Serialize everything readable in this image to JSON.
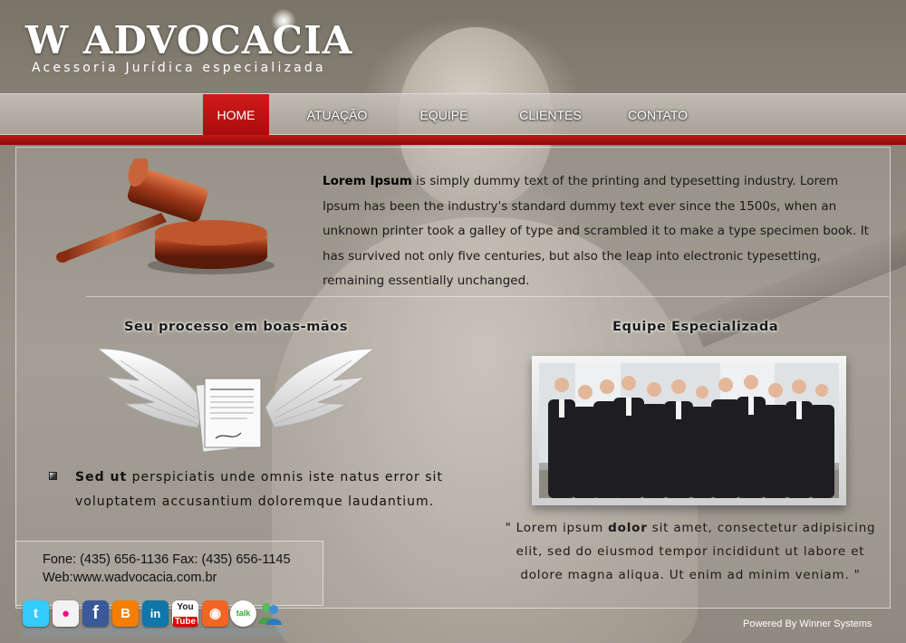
{
  "header": {
    "logo_title": "W ADVOCACIA",
    "logo_subtitle": "Acessoria Jurídica especializada"
  },
  "nav": {
    "items": [
      {
        "label": "HOME",
        "active": true
      },
      {
        "label": "ATUAÇÃO",
        "active": false
      },
      {
        "label": "EQUIPE",
        "active": false
      },
      {
        "label": "CLIENTES",
        "active": false
      },
      {
        "label": "CONTATO",
        "active": false
      }
    ]
  },
  "intro": {
    "lead": "Lorem Ipsum",
    "text": " is simply dummy text of the printing and typesetting industry. Lorem Ipsum has been the industry's standard dummy text ever since the 1500s, when an unknown printer took a galley of type and scrambled it to make a type specimen book. It has survived not only five centuries, but also the leap into electronic typesetting, remaining essentially unchanged."
  },
  "left_section": {
    "heading": "Seu processo em boas-mãos",
    "bold": "Sed ut",
    "text": " perspiciatis unde omnis iste natus error sit voluptatem accusantium doloremque laudantium."
  },
  "right_section": {
    "heading": "Equipe Especializada",
    "quote_before": "\" Lorem ipsum ",
    "quote_bold": "dolor",
    "quote_after": " sit amet, consectetur adipisicing elit, sed do eiusmod tempor incididunt ut labore et dolore magna aliqua. Ut enim ad minim veniam. \""
  },
  "contact": {
    "phone_line": "Fone: (435) 656-1136 Fax: (435) 656-1145",
    "web_line": "Web:www.wadvocacia.com.br"
  },
  "social": [
    {
      "icon": "twitter-icon",
      "glyph": "t",
      "color": "#33ccff"
    },
    {
      "icon": "flickr-icon",
      "glyph": "●",
      "color": "#f2f2f2"
    },
    {
      "icon": "facebook-icon",
      "glyph": "f",
      "color": "#3b5998"
    },
    {
      "icon": "blogger-icon",
      "glyph": "B",
      "color": "#f57d00"
    },
    {
      "icon": "linkedin-icon",
      "glyph": "in",
      "color": "#0e76a8"
    },
    {
      "icon": "youtube-icon",
      "glyph": "You",
      "color": "#ffffff"
    },
    {
      "icon": "rss-icon",
      "glyph": "◉",
      "color": "#f26522"
    },
    {
      "icon": "gtalk-icon",
      "glyph": "talk",
      "color": "#ffffff"
    },
    {
      "icon": "messenger-icon",
      "glyph": "●",
      "color": "#5cb85c"
    }
  ],
  "footer": {
    "powered_by": "Powered By Winner Systems"
  }
}
